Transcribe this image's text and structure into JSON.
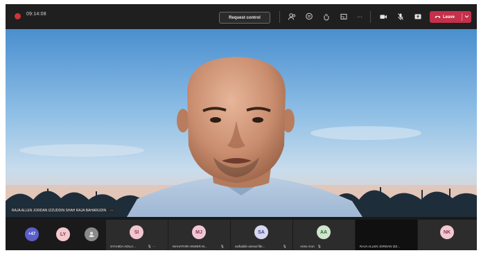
{
  "topbar": {
    "timer": "09:14:08",
    "request_control_label": "Request control",
    "leave_label": "Leave",
    "icons": [
      "participants-icon",
      "chat-icon",
      "reactions-icon",
      "rooms-icon",
      "more-icon",
      "camera-icon",
      "mic-icon",
      "share-icon"
    ],
    "leave_color": "#c4314b",
    "record_color": "#d13438"
  },
  "stage": {
    "speaker_name": "RAJA ALLEN JORDAN IZZUDDIN SHAH RAJA BAHARUDIN"
  },
  "participants": {
    "overflow_count": "+47",
    "avatars": [
      {
        "initials": "LY",
        "color": "#f3c8cf",
        "text_color": "#8a3a4a"
      },
      {
        "initials": "SI",
        "color": "#f0c6cf",
        "text_color": "#8a3a4a",
        "name": "SYAHIDA ADILA..."
      },
      {
        "initials": "MJ",
        "color": "#f1c7d6",
        "text_color": "#8a3a4a",
        "name": "MAHATHIR ANWER M..."
      },
      {
        "initials": "SA",
        "color": "#d7d8f0",
        "text_color": "#3f4281",
        "name": "saifuddin ariesul fikr..."
      },
      {
        "initials": "AA",
        "color": "#cfe5cf",
        "text_color": "#2d6a2d",
        "name": "Aries Aron"
      },
      {
        "initials": "NK",
        "color": "#f2c8d3",
        "text_color": "#8a3a4a"
      }
    ],
    "self_name": "RAJA ALLEN JORDAN IZZ..."
  }
}
